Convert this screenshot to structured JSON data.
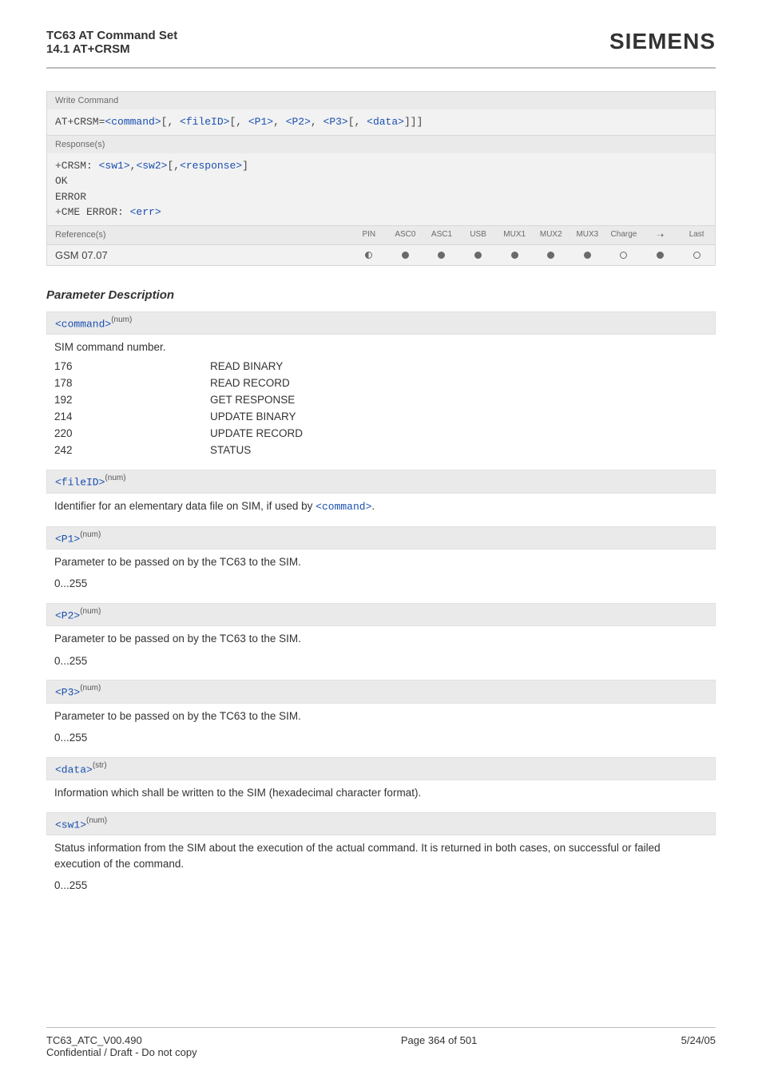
{
  "header": {
    "title1": "TC63 AT Command Set",
    "title2": "14.1 AT+CRSM",
    "brand": "SIEMENS"
  },
  "box": {
    "write_label": "Write Command",
    "write_cmd_prefix": "AT+CRSM=",
    "p_command": "<command>",
    "p_fileid": "<fileID>",
    "p_p1": "<P1>",
    "p_p2": "<P2>",
    "p_p3": "<P3>",
    "p_data": "<data>",
    "response_label": "Response(s)",
    "resp_crsm": "+CRSM: ",
    "resp_sw1": "<sw1>",
    "resp_sw2": "<sw2>",
    "resp_response": "<response>",
    "resp_ok": "OK",
    "resp_error": "ERROR",
    "resp_cme": "+CME ERROR: ",
    "resp_err": "<err>",
    "ref_label": "Reference(s)",
    "ref_value": "GSM 07.07",
    "cols": [
      "PIN",
      "ASC0",
      "ASC1",
      "USB",
      "MUX1",
      "MUX2",
      "MUX3",
      "Charge",
      "➝",
      "Last"
    ]
  },
  "section_heading": "Parameter Description",
  "params": {
    "command": {
      "name": "<command>",
      "type": "(num)",
      "desc": "SIM command number.",
      "rows": [
        {
          "c1": "176",
          "c2": "READ BINARY"
        },
        {
          "c1": "178",
          "c2": "READ RECORD"
        },
        {
          "c1": "192",
          "c2": "GET RESPONSE"
        },
        {
          "c1": "214",
          "c2": "UPDATE BINARY"
        },
        {
          "c1": "220",
          "c2": "UPDATE RECORD"
        },
        {
          "c1": "242",
          "c2": "STATUS"
        }
      ]
    },
    "fileid": {
      "name": "<fileID>",
      "type": "(num)",
      "desc_pre": "Identifier for an elementary data file on SIM, if used by ",
      "desc_link": "<command>",
      "desc_post": "."
    },
    "p1": {
      "name": "<P1>",
      "type": "(num)",
      "desc": "Parameter to be passed on by the TC63 to the SIM.",
      "range": "0...255"
    },
    "p2": {
      "name": "<P2>",
      "type": "(num)",
      "desc": "Parameter to be passed on by the TC63 to the SIM.",
      "range": "0...255"
    },
    "p3": {
      "name": "<P3>",
      "type": "(num)",
      "desc": "Parameter to be passed on by the TC63 to the SIM.",
      "range": "0...255"
    },
    "data": {
      "name": "<data>",
      "type": "(str)",
      "desc": "Information which shall be written to the SIM (hexadecimal character format)."
    },
    "sw1": {
      "name": "<sw1>",
      "type": "(num)",
      "desc": "Status information from the SIM about the execution of the actual command. It is returned in both cases, on successful or failed execution of the command.",
      "range": "0...255"
    }
  },
  "footer": {
    "left1": "TC63_ATC_V00.490",
    "left2": "Confidential / Draft - Do not copy",
    "center": "Page 364 of 501",
    "right": "5/24/05"
  }
}
